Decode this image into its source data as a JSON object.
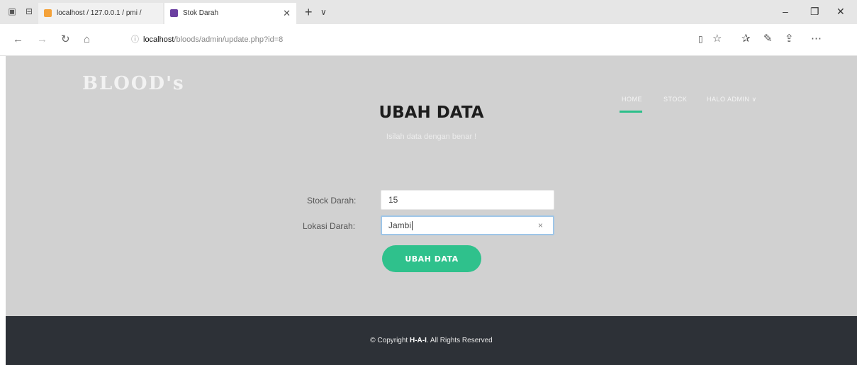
{
  "browser": {
    "tabs": [
      {
        "title": "localhost / 127.0.0.1 / pmi /",
        "favicon_color": "#f4a23a"
      },
      {
        "title": "Stok Darah",
        "favicon_color": "#6b3fa0"
      }
    ],
    "new_tab": "+",
    "tab_menu": "∨",
    "url_host": "localhost",
    "url_path": "/bloods/admin/update.php?id=8",
    "window_controls": {
      "minimize": "–",
      "maximize": "❐",
      "close": "✕"
    }
  },
  "site": {
    "logo": "BLOOD's",
    "menu": {
      "home": "HOME",
      "stock": "STOCK",
      "halo_admin": "HALO ADMIN ∨"
    },
    "accent_color": "#2bbf8a"
  },
  "form": {
    "title": "UBAH DATA",
    "subtitle": "Isilah data dengan benar !",
    "stock_label": "Stock Darah:",
    "stock_value": "15",
    "lokasi_label": "Lokasi Darah:",
    "lokasi_value": "Jambi",
    "clear_icon": "×",
    "submit_label": "UBAH DATA"
  },
  "footer": {
    "prefix": "© Copyright ",
    "brand": "H-A-I",
    "suffix": ". All Rights Reserved"
  }
}
